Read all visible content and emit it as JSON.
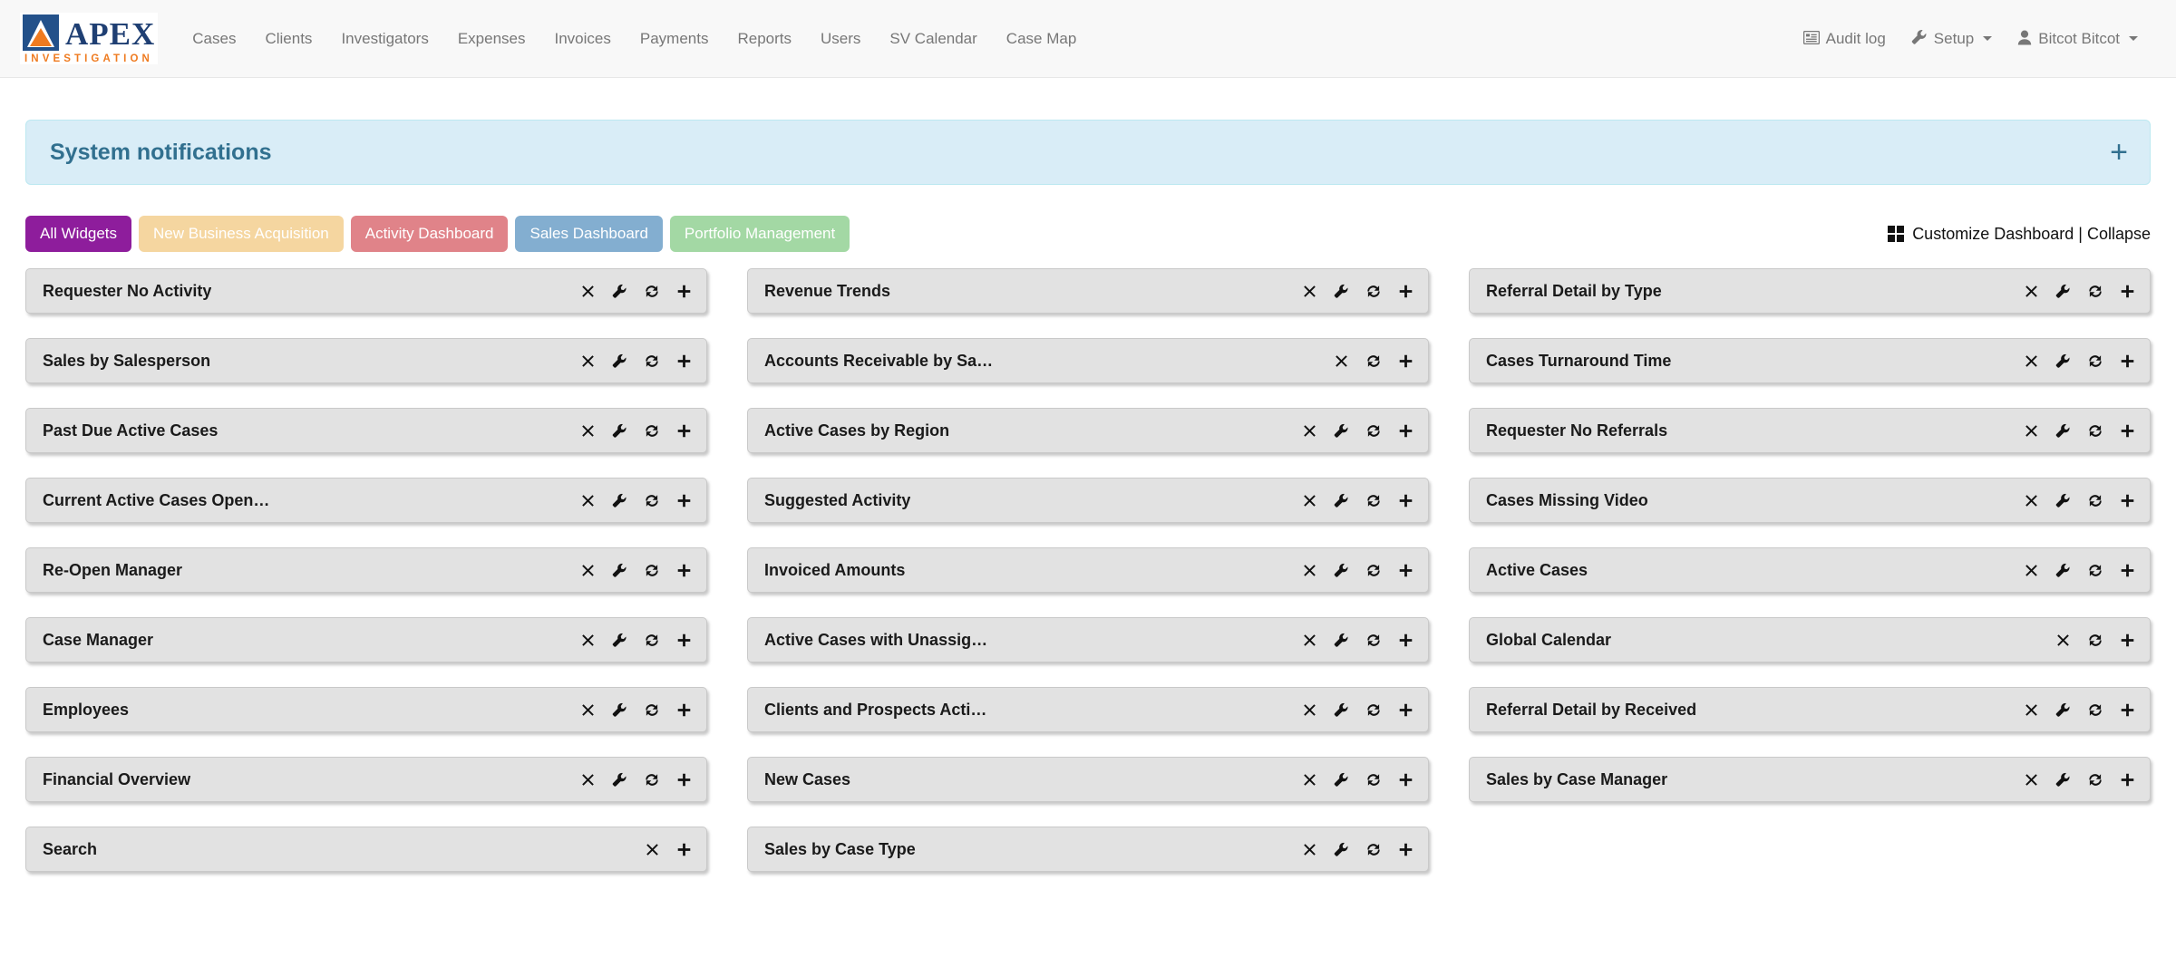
{
  "navbar": {
    "logo": {
      "word": "APEX",
      "sub": "INVESTIGATION",
      "mark": "apex-triangle-logo"
    },
    "links": [
      "Cases",
      "Clients",
      "Investigators",
      "Expenses",
      "Invoices",
      "Payments",
      "Reports",
      "Users",
      "SV Calendar",
      "Case Map"
    ],
    "right": [
      {
        "label": "Audit log",
        "icon": "list-icon",
        "caret": false
      },
      {
        "label": "Setup",
        "icon": "wrench-icon",
        "caret": true
      },
      {
        "label": "Bitcot Bitcot",
        "icon": "user-icon",
        "caret": true
      }
    ]
  },
  "notifications": {
    "title": "System notifications",
    "expand_label": "+",
    "bg": "#d9edf7",
    "fg": "#31708f"
  },
  "tabs": [
    {
      "label": "All Widgets",
      "color": "#8e1d9c",
      "active": true
    },
    {
      "label": "New Business Acquisition",
      "color": "#f5d6a0",
      "active": false
    },
    {
      "label": "Activity Dashboard",
      "color": "#e08389",
      "active": false
    },
    {
      "label": "Sales Dashboard",
      "color": "#83aed0",
      "active": false
    },
    {
      "label": "Portfolio Management",
      "color": "#a3d8a4",
      "active": false
    }
  ],
  "customize": {
    "icon": "grid-icon",
    "label": "Customize Dashboard | Collapse"
  },
  "columns": [
    {
      "widgets": [
        {
          "title": "Requester No Activity",
          "actions": [
            "close",
            "wrench",
            "refresh",
            "plus"
          ]
        },
        {
          "title": "Sales by Salesperson",
          "actions": [
            "close",
            "wrench",
            "refresh",
            "plus"
          ]
        },
        {
          "title": "Past Due Active Cases",
          "actions": [
            "close",
            "wrench",
            "refresh",
            "plus"
          ]
        },
        {
          "title": "Current Active Cases Open…",
          "actions": [
            "close",
            "wrench",
            "refresh",
            "plus"
          ]
        },
        {
          "title": "Re-Open Manager",
          "actions": [
            "close",
            "wrench",
            "refresh",
            "plus"
          ]
        },
        {
          "title": "Case Manager",
          "actions": [
            "close",
            "wrench",
            "refresh",
            "plus"
          ]
        },
        {
          "title": "Employees",
          "actions": [
            "close",
            "wrench",
            "refresh",
            "plus"
          ]
        },
        {
          "title": "Financial Overview",
          "actions": [
            "close",
            "wrench",
            "refresh",
            "plus"
          ]
        },
        {
          "title": "Search",
          "actions": [
            "close",
            "plus"
          ]
        }
      ]
    },
    {
      "widgets": [
        {
          "title": "Revenue Trends",
          "actions": [
            "close",
            "wrench",
            "refresh",
            "plus"
          ]
        },
        {
          "title": "Accounts Receivable by Sa…",
          "actions": [
            "close",
            "refresh",
            "plus"
          ]
        },
        {
          "title": "Active Cases by Region",
          "actions": [
            "close",
            "wrench",
            "refresh",
            "plus"
          ]
        },
        {
          "title": "Suggested Activity",
          "actions": [
            "close",
            "wrench",
            "refresh",
            "plus"
          ]
        },
        {
          "title": "Invoiced Amounts",
          "actions": [
            "close",
            "wrench",
            "refresh",
            "plus"
          ]
        },
        {
          "title": "Active Cases with Unassig…",
          "actions": [
            "close",
            "wrench",
            "refresh",
            "plus"
          ]
        },
        {
          "title": "Clients and Prospects Acti…",
          "actions": [
            "close",
            "wrench",
            "refresh",
            "plus"
          ]
        },
        {
          "title": "New Cases",
          "actions": [
            "close",
            "wrench",
            "refresh",
            "plus"
          ]
        },
        {
          "title": "Sales by Case Type",
          "actions": [
            "close",
            "wrench",
            "refresh",
            "plus"
          ]
        }
      ]
    },
    {
      "widgets": [
        {
          "title": "Referral Detail by Type",
          "actions": [
            "close",
            "wrench",
            "refresh",
            "plus"
          ]
        },
        {
          "title": "Cases Turnaround Time",
          "actions": [
            "close",
            "wrench",
            "refresh",
            "plus"
          ]
        },
        {
          "title": "Requester No Referrals",
          "actions": [
            "close",
            "wrench",
            "refresh",
            "plus"
          ]
        },
        {
          "title": "Cases Missing Video",
          "actions": [
            "close",
            "wrench",
            "refresh",
            "plus"
          ]
        },
        {
          "title": "Active Cases",
          "actions": [
            "close",
            "wrench",
            "refresh",
            "plus"
          ]
        },
        {
          "title": "Global Calendar",
          "actions": [
            "close",
            "refresh",
            "plus"
          ]
        },
        {
          "title": "Referral Detail by Received",
          "actions": [
            "close",
            "wrench",
            "refresh",
            "plus"
          ]
        },
        {
          "title": "Sales by Case Manager",
          "actions": [
            "close",
            "wrench",
            "refresh",
            "plus"
          ]
        }
      ]
    }
  ]
}
